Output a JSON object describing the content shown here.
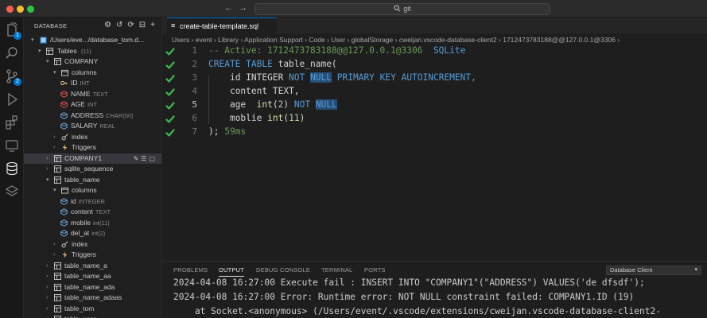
{
  "titlebar": {
    "search_text": "git",
    "back_arrow": "←",
    "forward_arrow": "→"
  },
  "activity": {
    "explorer_badge": "1",
    "scm_badge": "2"
  },
  "sidebar": {
    "title": "DATABASE",
    "connection": "/Users/eve.../database_tom.d...",
    "tables_label": "Tables",
    "tables_count": "(11)",
    "items": [
      {
        "label": "COMPANY",
        "type": ""
      },
      {
        "label": "columns",
        "type": ""
      },
      {
        "label": "ID",
        "type": "INT"
      },
      {
        "label": "NAME",
        "type": "TEXT"
      },
      {
        "label": "AGE",
        "type": "INT"
      },
      {
        "label": "ADDRESS",
        "type": "CHAR(50)"
      },
      {
        "label": "SALARY",
        "type": "REAL"
      },
      {
        "label": "index",
        "type": ""
      },
      {
        "label": "Triggers",
        "type": ""
      },
      {
        "label": "COMPANY1",
        "type": ""
      },
      {
        "label": "sqlite_sequence",
        "type": ""
      },
      {
        "label": "table_name",
        "type": ""
      },
      {
        "label": "columns",
        "type": ""
      },
      {
        "label": "id",
        "type": "INTEGER"
      },
      {
        "label": "content",
        "type": "TEXT"
      },
      {
        "label": "mobile",
        "type": "int(11)"
      },
      {
        "label": "del_at",
        "type": "int(2)"
      },
      {
        "label": "index",
        "type": ""
      },
      {
        "label": "Triggers",
        "type": ""
      },
      {
        "label": "table_name_a",
        "type": ""
      },
      {
        "label": "table_name_aa",
        "type": ""
      },
      {
        "label": "table_name_ada",
        "type": ""
      },
      {
        "label": "table_name_adaas",
        "type": ""
      },
      {
        "label": "table_tom",
        "type": ""
      },
      {
        "label": "table_user",
        "type": ""
      }
    ]
  },
  "editor": {
    "tab_label": "create-table-template.sql",
    "breadcrumb": "Users › event › Library › Application Support › Code › User › globalStorage › cweijan.vscode-database-client2 › 1712473783188@@127.0.0.1@3306 ›",
    "line_numbers": [
      "1",
      "2",
      "3",
      "4",
      "5",
      "6",
      "7"
    ],
    "lines": {
      "l1_comment": "-- Active: 1712473783188@@127.0.0.1@3306",
      "l1_db": "SQLite",
      "l2_kw": "CREATE TABLE",
      "l2_name": "table_name(",
      "l3_col": "id",
      "l3_type": "INTEGER",
      "l3_not": "NOT",
      "l3_null": "NULL",
      "l3_rest": "PRIMARY KEY AUTOINCREMENT,",
      "l4_col": "content",
      "l4_type": "TEXT,",
      "l5_col": "age",
      "l5_fn": "int",
      "l5_num": "2",
      "l5_not": "NOT",
      "l5_null": "NULL",
      "l6_col": "moblie",
      "l6_fn": "int",
      "l6_num": "11",
      "l7_close": ");",
      "l7_time": "59ms"
    }
  },
  "panel": {
    "tabs": [
      "PROBLEMS",
      "OUTPUT",
      "DEBUG CONSOLE",
      "TERMINAL",
      "PORTS"
    ],
    "channel": "Database Client",
    "output_lines": [
      "2024-04-08 16:27:00 Execute fail : INSERT INTO \"COMPANY1\"(\"ADDRESS\") VALUES('de dfsdf');",
      "2024-04-08 16:27:00 Error: Runtime error: NOT NULL constraint failed: COMPANY1.ID (19)",
      "    at Socket.<anonymous> (/Users/event/.vscode/extensions/cweijan.vscode-database-client2-"
    ]
  },
  "colors": {
    "accent": "#0078d4",
    "check": "#3fb950",
    "keyword": "#569cd6",
    "comment": "#6a9955"
  }
}
